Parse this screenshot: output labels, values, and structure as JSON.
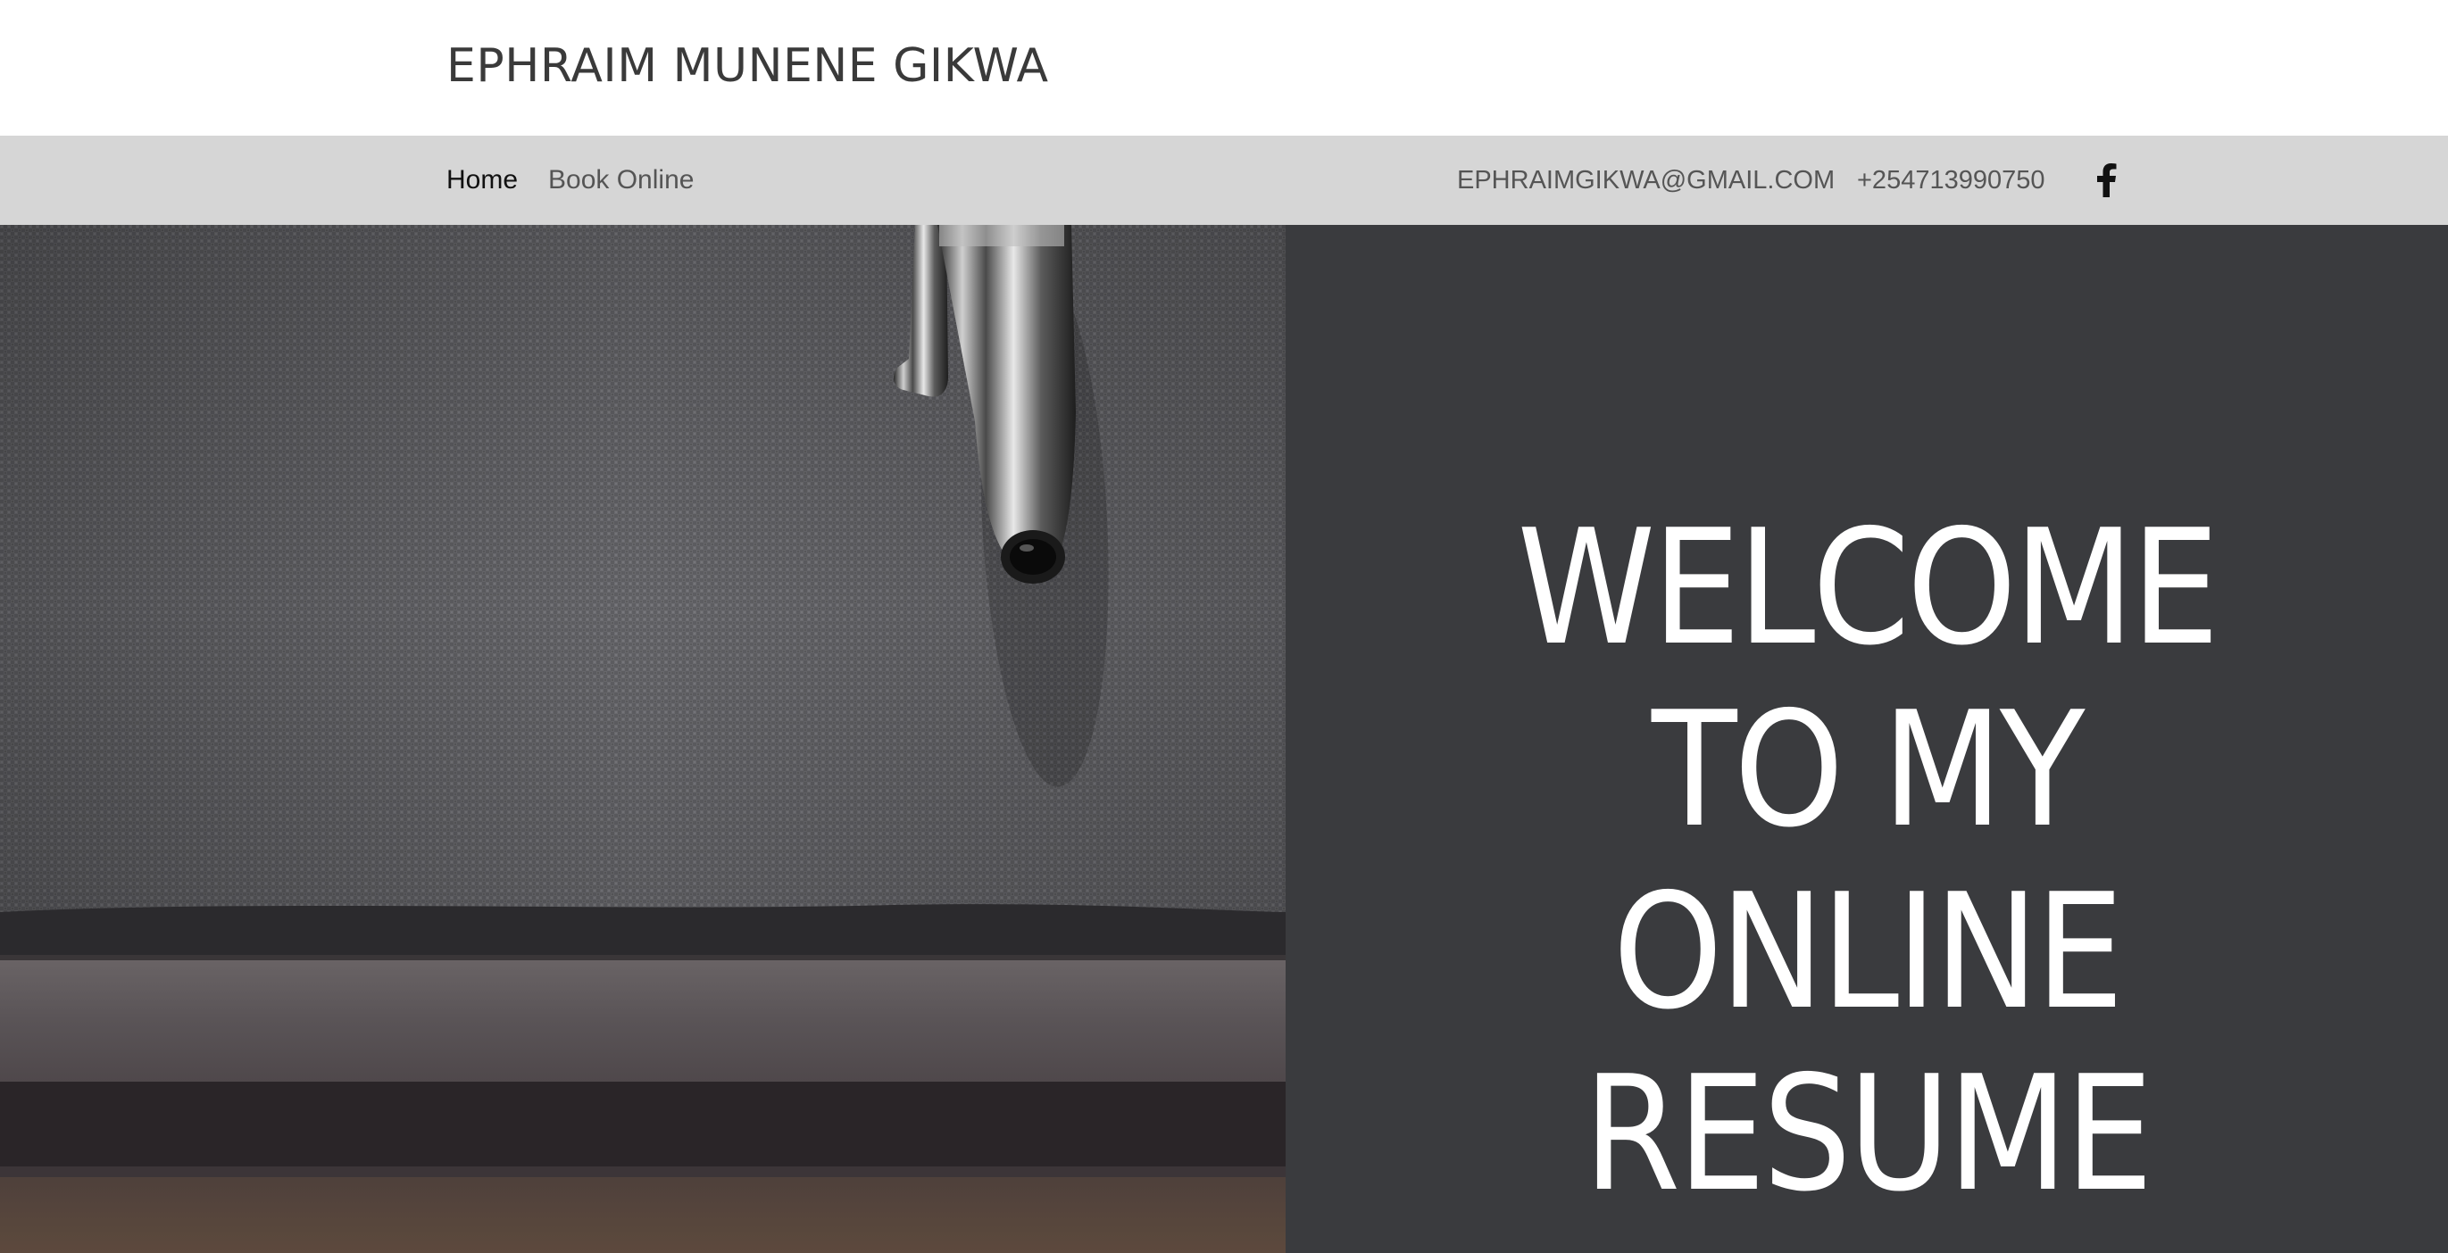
{
  "header": {
    "site_title": "EPHRAIM MUNENE GIKWA"
  },
  "nav": {
    "items": [
      {
        "label": "Home",
        "active": true
      },
      {
        "label": "Book Online",
        "active": false
      }
    ],
    "email": "EPHRAIMGIKWA@GMAIL.COM",
    "phone": "+254713990750",
    "social_icon": "facebook-icon"
  },
  "hero": {
    "heading_lines": [
      "WELCOME",
      "TO MY",
      "ONLINE",
      "RESUME"
    ],
    "image_subject": "pen-on-notebook-photo"
  },
  "colors": {
    "navbar_bg": "#d6d6d6",
    "hero_panel_bg": "#3a3b3e",
    "title_text": "#3a3a3a",
    "hero_text": "#ffffff"
  }
}
